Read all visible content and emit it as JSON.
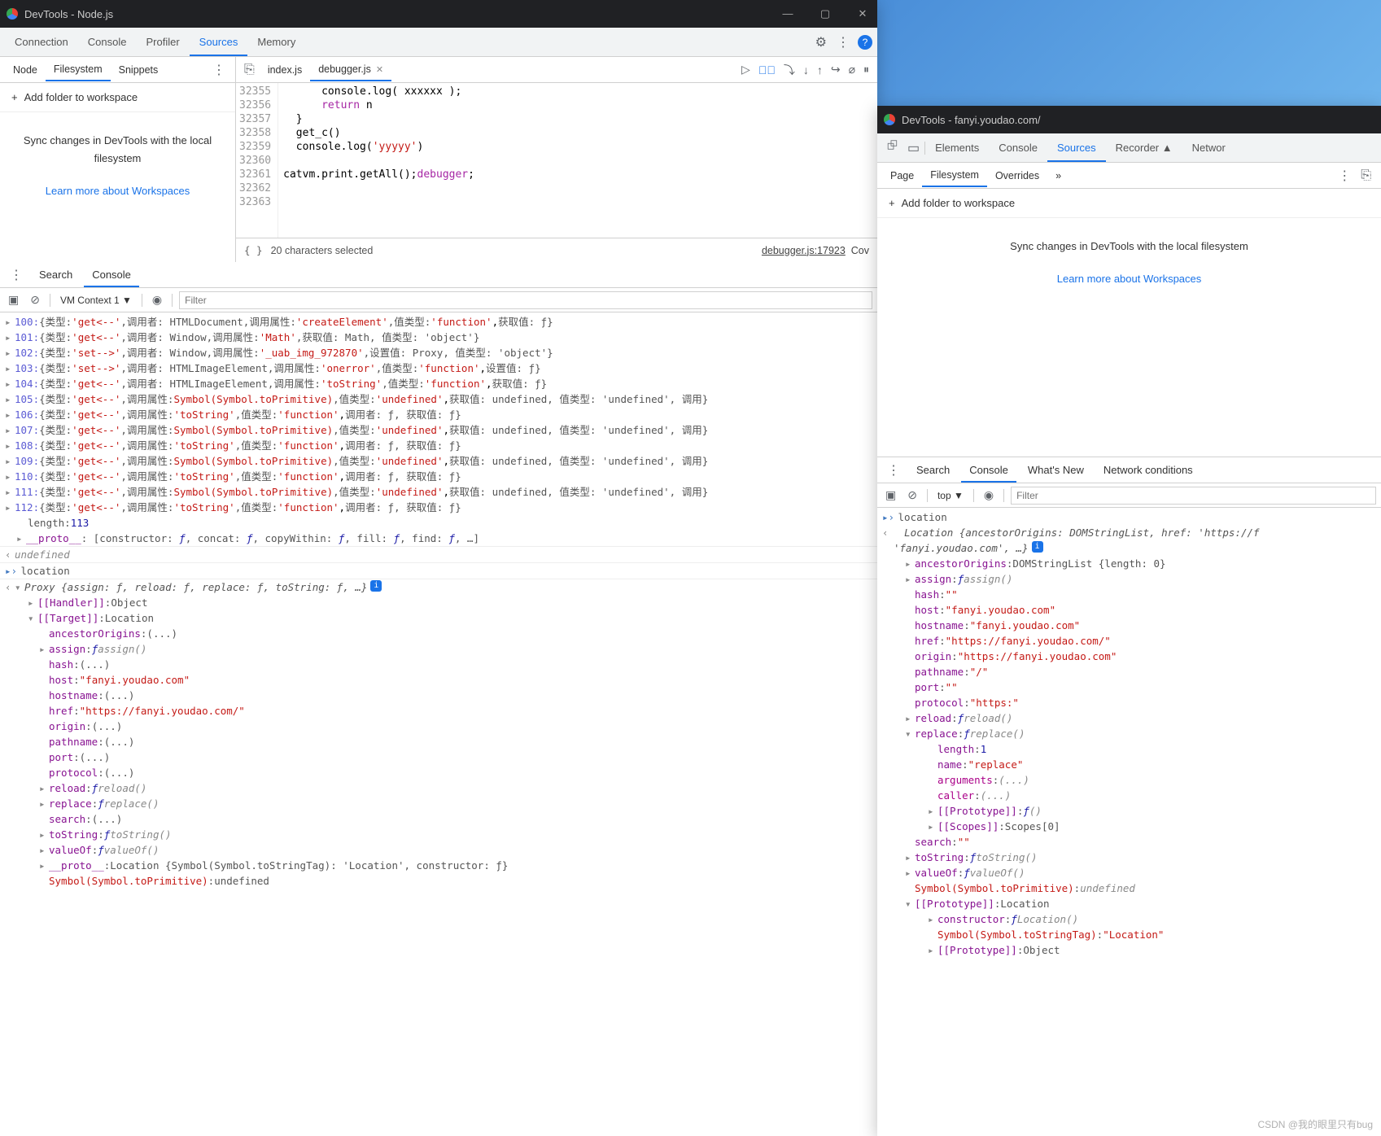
{
  "win1": {
    "title": "DevTools - Node.js",
    "top_tabs": [
      "Connection",
      "Console",
      "Profiler",
      "Sources",
      "Memory"
    ],
    "top_active": "Sources",
    "sub_tabs": [
      "Node",
      "Filesystem",
      "Snippets"
    ],
    "sub_active": "Filesystem",
    "add_folder": "Add folder to workspace",
    "sync_msg": "Sync changes in DevTools with the local filesystem",
    "learn_more": "Learn more about Workspaces",
    "file_tabs": [
      {
        "name": "index.js",
        "active": false
      },
      {
        "name": "debugger.js",
        "active": true
      }
    ],
    "code": {
      "start": 32355,
      "lines": [
        "      console.log( xxxxxx );",
        "      return n",
        "  }",
        "  get_c()",
        "  console.log('yyyyy')",
        "",
        "  catvm.print.getAll();debugger;",
        "",
        ""
      ],
      "highlight_index": 6
    },
    "status_sel": "20 characters selected",
    "status_file": "debugger.js:17923",
    "status_cov": "Cov",
    "console_tabs": [
      "Search",
      "Console"
    ],
    "console_active": "Console",
    "ctx": "VM Context 1 ▼",
    "filter_ph": "Filter",
    "log_rows": [
      {
        "n": "100",
        "t": "get<--",
        "caller": "HTMLDocument",
        "attr_lbl": "调用属性",
        "attr": "'createElement'",
        "vt": "'function'",
        "extra": "获取值: ƒ"
      },
      {
        "n": "101",
        "t": "get<--",
        "caller": "Window",
        "attr_lbl": "调用属性",
        "attr": "'Math'",
        "vt": "",
        "extra": "获取值: Math, 值类型: 'object'"
      },
      {
        "n": "102",
        "t": "set-->",
        "caller": "Window",
        "attr_lbl": "调用属性",
        "attr": "'_uab_img_972870'",
        "vt": "",
        "extra": "设置值: Proxy, 值类型: 'object'"
      },
      {
        "n": "103",
        "t": "set-->",
        "caller": "HTMLImageElement",
        "attr_lbl": "调用属性",
        "attr": "'onerror'",
        "vt": "'function'",
        "extra": "设置值: ƒ"
      },
      {
        "n": "104",
        "t": "get<--",
        "caller": "HTMLImageElement",
        "attr_lbl": "调用属性",
        "attr": "'toString'",
        "vt": "'function'",
        "extra": "获取值: ƒ"
      },
      {
        "n": "105",
        "t": "get<--",
        "caller": "",
        "attr_lbl": "调用属性",
        "attr": "Symbol(Symbol.toPrimitive)",
        "vt": "'undefined'",
        "extra": "获取值: undefined, 值类型: 'undefined', 调用"
      },
      {
        "n": "106",
        "t": "get<--",
        "caller": "",
        "attr_lbl": "调用属性",
        "attr": "'toString'",
        "vt": "'function'",
        "extra": "调用者: ƒ, 获取值: ƒ"
      },
      {
        "n": "107",
        "t": "get<--",
        "caller": "",
        "attr_lbl": "调用属性",
        "attr": "Symbol(Symbol.toPrimitive)",
        "vt": "'undefined'",
        "extra": "获取值: undefined, 值类型: 'undefined', 调用"
      },
      {
        "n": "108",
        "t": "get<--",
        "caller": "",
        "attr_lbl": "调用属性",
        "attr": "'toString'",
        "vt": "'function'",
        "extra": "调用者: ƒ, 获取值: ƒ"
      },
      {
        "n": "109",
        "t": "get<--",
        "caller": "",
        "attr_lbl": "调用属性",
        "attr": "Symbol(Symbol.toPrimitive)",
        "vt": "'undefined'",
        "extra": "获取值: undefined, 值类型: 'undefined', 调用"
      },
      {
        "n": "110",
        "t": "get<--",
        "caller": "",
        "attr_lbl": "调用属性",
        "attr": "'toString'",
        "vt": "'function'",
        "extra": "调用者: ƒ, 获取值: ƒ"
      },
      {
        "n": "111",
        "t": "get<--",
        "caller": "",
        "attr_lbl": "调用属性",
        "attr": "Symbol(Symbol.toPrimitive)",
        "vt": "'undefined'",
        "extra": "获取值: undefined, 值类型: 'undefined', 调用"
      },
      {
        "n": "112",
        "t": "get<--",
        "caller": "",
        "attr_lbl": "调用属性",
        "attr": "'toString'",
        "vt": "'function'",
        "extra": "调用者: ƒ, 获取值: ƒ"
      }
    ],
    "length_line": "length: 113",
    "proto_line": "__proto__: [constructor: ƒ, concat: ƒ, copyWithin: ƒ, fill: ƒ, find: ƒ, …]",
    "undef": "undefined",
    "loc": "location",
    "proxy_head": "Proxy {assign: ƒ, reload: ƒ, replace: ƒ, toString: ƒ, …}",
    "proxy_props": [
      {
        "k": "[[Handler]]",
        "v": "Object",
        "exp": "r"
      },
      {
        "k": "[[Target]]",
        "v": "Location",
        "exp": "d"
      },
      {
        "k": "ancestorOrigins",
        "v": "(...)",
        "ml": 4
      },
      {
        "k": "assign",
        "v": "ƒ assign()",
        "ml": 4,
        "exp": "r"
      },
      {
        "k": "hash",
        "v": "(...)",
        "ml": 4
      },
      {
        "k": "host",
        "v": "\"fanyi.youdao.com\"",
        "ml": 4,
        "str": true
      },
      {
        "k": "hostname",
        "v": "(...)",
        "ml": 4
      },
      {
        "k": "href",
        "v": "\"https://fanyi.youdao.com/\"",
        "ml": 4,
        "str": true
      },
      {
        "k": "origin",
        "v": "(...)",
        "ml": 4
      },
      {
        "k": "pathname",
        "v": "(...)",
        "ml": 4
      },
      {
        "k": "port",
        "v": "(...)",
        "ml": 4
      },
      {
        "k": "protocol",
        "v": "(...)",
        "ml": 4
      },
      {
        "k": "reload",
        "v": "ƒ reload()",
        "ml": 4,
        "exp": "r"
      },
      {
        "k": "replace",
        "v": "ƒ replace()",
        "ml": 4,
        "exp": "r"
      },
      {
        "k": "search",
        "v": "(...)",
        "ml": 4
      },
      {
        "k": "toString",
        "v": "ƒ toString()",
        "ml": 4,
        "exp": "r"
      },
      {
        "k": "valueOf",
        "v": "ƒ valueOf()",
        "ml": 4,
        "exp": "r"
      },
      {
        "k": "__proto__",
        "v": "Location {Symbol(Symbol.toStringTag): 'Location', constructor: ƒ}",
        "ml": 4,
        "exp": "r"
      },
      {
        "k": "Symbol(Symbol.toPrimitive)",
        "v": "undefined",
        "ml": 4,
        "sym": true
      }
    ]
  },
  "win2": {
    "title": "DevTools - fanyi.youdao.com/",
    "top_tabs": [
      "Elements",
      "Console",
      "Sources",
      "Recorder ▲",
      "Networ"
    ],
    "top_active": "Sources",
    "sub_tabs": [
      "Page",
      "Filesystem",
      "Overrides",
      "»"
    ],
    "sub_active": "Filesystem",
    "add_folder": "Add folder to workspace",
    "sync_msg": "Sync changes in DevTools with the local filesystem",
    "learn_more": "Learn more about Workspaces",
    "console_tabs": [
      "Search",
      "Console",
      "What's New",
      "Network conditions"
    ],
    "console_active": "Console",
    "ctx": "top ▼",
    "filter_ph": "Filter",
    "loc_head": "location",
    "loc_obj": "Location {ancestorOrigins: DOMStringList, href: 'https://f",
    "loc_obj2": "'fanyi.youdao.com', …}",
    "props": [
      {
        "k": "ancestorOrigins",
        "v": "DOMStringList {length: 0}",
        "exp": "r"
      },
      {
        "k": "assign",
        "v": "ƒ assign()",
        "exp": "r"
      },
      {
        "k": "hash",
        "v": "\"\"",
        "str": true
      },
      {
        "k": "host",
        "v": "\"fanyi.youdao.com\"",
        "str": true
      },
      {
        "k": "hostname",
        "v": "\"fanyi.youdao.com\"",
        "str": true
      },
      {
        "k": "href",
        "v": "\"https://fanyi.youdao.com/\"",
        "str": true
      },
      {
        "k": "origin",
        "v": "\"https://fanyi.youdao.com\"",
        "str": true
      },
      {
        "k": "pathname",
        "v": "\"/\"",
        "str": true
      },
      {
        "k": "port",
        "v": "\"\"",
        "str": true
      },
      {
        "k": "protocol",
        "v": "\"https:\"",
        "str": true
      },
      {
        "k": "reload",
        "v": "ƒ reload()",
        "exp": "r"
      },
      {
        "k": "replace",
        "v": "ƒ replace()",
        "exp": "d"
      },
      {
        "k": "length",
        "v": "1",
        "ml": 5,
        "blue": true
      },
      {
        "k": "name",
        "v": "\"replace\"",
        "ml": 5,
        "str": true
      },
      {
        "k": "arguments",
        "v": "(...)",
        "ml": 5,
        "dim": true
      },
      {
        "k": "caller",
        "v": "(...)",
        "ml": 5,
        "dim": true
      },
      {
        "k": "[[Prototype]]",
        "v": "ƒ ()",
        "ml": 5,
        "exp": "r"
      },
      {
        "k": "[[Scopes]]",
        "v": "Scopes[0]",
        "ml": 5,
        "exp": "r"
      },
      {
        "k": "search",
        "v": "\"\"",
        "str": true
      },
      {
        "k": "toString",
        "v": "ƒ toString()",
        "exp": "r"
      },
      {
        "k": "valueOf",
        "v": "ƒ valueOf()",
        "exp": "r"
      },
      {
        "k": "Symbol(Symbol.toPrimitive)",
        "v": "undefined",
        "sym": true
      },
      {
        "k": "[[Prototype]]",
        "v": "Location",
        "exp": "d"
      },
      {
        "k": "constructor",
        "v": "ƒ Location()",
        "ml": 5,
        "exp": "r"
      },
      {
        "k": "Symbol(Symbol.toStringTag)",
        "v": "\"Location\"",
        "ml": 5,
        "sym": true,
        "str": true
      },
      {
        "k": "[[Prototype]]",
        "v": "Object",
        "ml": 5,
        "exp": "r"
      }
    ]
  },
  "watermark": "CSDN @我的眼里只有bug"
}
